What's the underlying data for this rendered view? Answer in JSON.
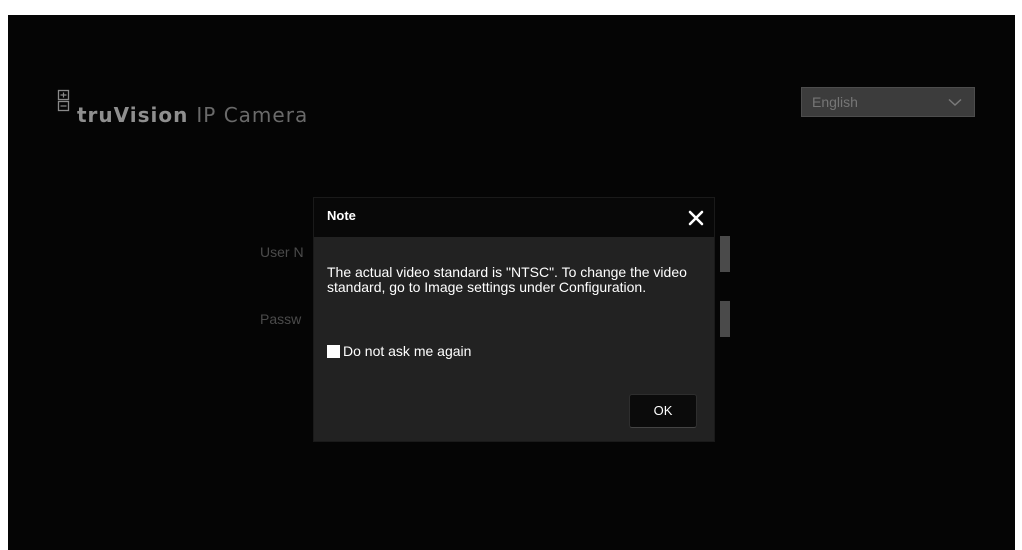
{
  "header": {
    "logo_brand": "truVision",
    "logo_product": "IP Camera"
  },
  "language_select": {
    "selected": "English"
  },
  "login_form": {
    "username_label": "User N",
    "password_label": "Passw"
  },
  "dialog": {
    "title": "Note",
    "message": "The actual video standard is \"NTSC\". To change the video standard, go to Image settings under Configuration.",
    "checkbox_label": "Do not ask me again",
    "checkbox_checked": false,
    "ok_label": "OK"
  },
  "icons": [
    "logo-mark-icon",
    "chevron-down-icon",
    "close-icon"
  ],
  "colors": {
    "page_background": "#050505",
    "dialog_background": "#222222",
    "dialog_header": "#080808",
    "text_primary": "#ffffff",
    "logo_text": "#8f8f8f"
  }
}
